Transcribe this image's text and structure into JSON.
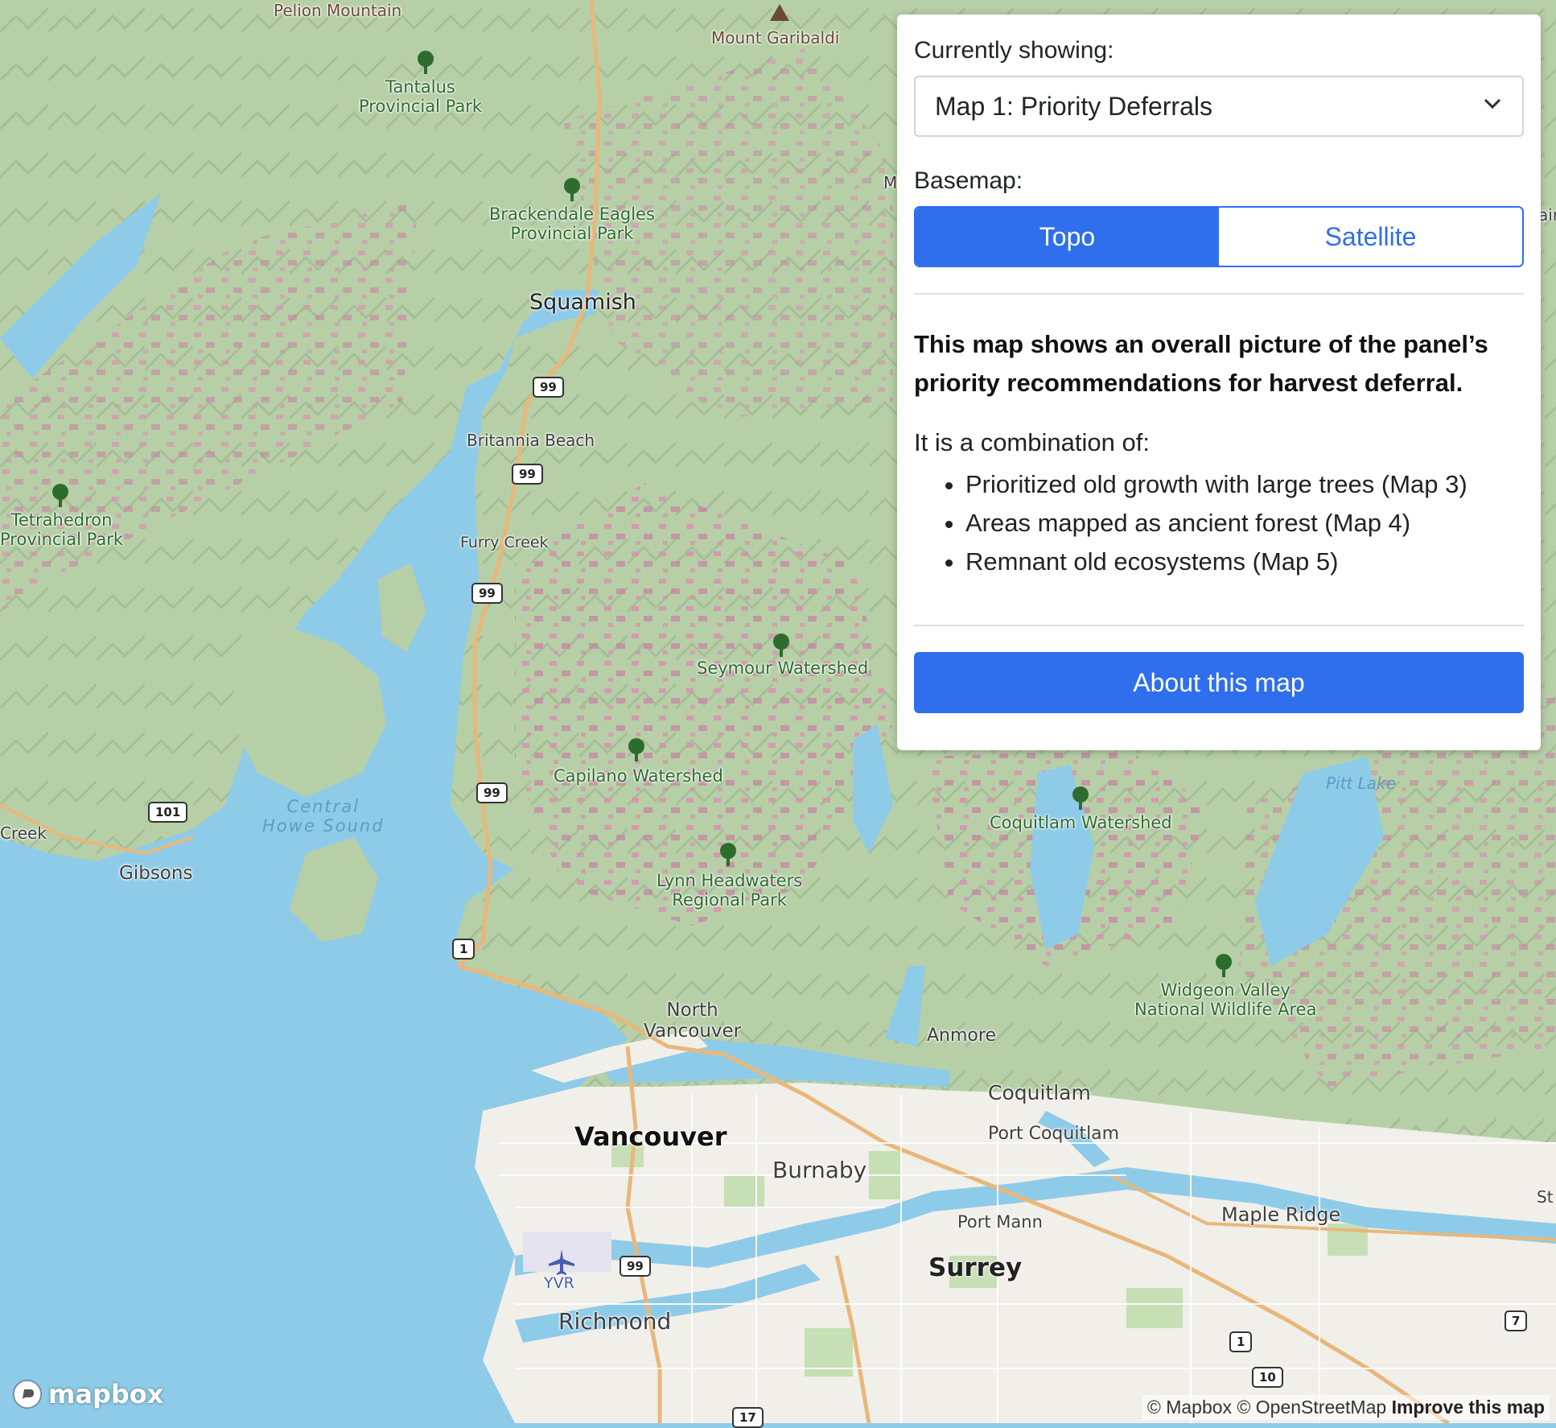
{
  "panel": {
    "currently_showing_label": "Currently showing:",
    "selected_map": "Map 1: Priority Deferrals",
    "basemap_label": "Basemap:",
    "basemap_options": [
      "Topo",
      "Satellite"
    ],
    "basemap_selected": "Topo",
    "description_bold": "This map shows an overall picture of the panel’s priority recommendations for harvest deferral.",
    "combination_intro": "It is a combination of:",
    "combination_items": [
      "Prioritized old growth with large trees (Map 3)",
      "Areas mapped as ancient forest (Map 4)",
      "Remnant old ecosystems (Map 5)"
    ],
    "about_button": "About this map"
  },
  "map": {
    "labels": {
      "pelion": "Pelion Mountain",
      "garibaldi": "Mount Garibaldi",
      "tantalus": "Tantalus\nProvincial Park",
      "brackendale": "Brackendale Eagles\nProvincial Park",
      "squamish": "Squamish",
      "britannia": "Britannia Beach",
      "furry": "Furry Creek",
      "tetrahedron": "Tetrahedron\nProvincial Park",
      "seymour": "Seymour Watershed",
      "capilano": "Capilano Watershed",
      "central": "Central\nHowe Sound",
      "creek": "Creek",
      "gibsons": "Gibsons",
      "lynn": "Lynn Headwaters\nRegional Park",
      "coquitlam_ws": "Coquitlam Watershed",
      "pitt": "Pitt Lake",
      "widgeon": "Widgeon Valley\nNational Wildlife Area",
      "north_van": "North\nVancouver",
      "anmore": "Anmore",
      "coquitlam": "Coquitlam",
      "port_coquitlam": "Port Coquitlam",
      "vancouver": "Vancouver",
      "burnaby": "Burnaby",
      "port_mann": "Port Mann",
      "maple_ridge": "Maple Ridge",
      "surrey": "Surrey",
      "yvr": "YVR",
      "richmond": "Richmond",
      "m_partial": "M",
      "ain_partial": "ain",
      "st_partial": "St"
    },
    "route_shields": [
      "99",
      "99",
      "99",
      "99",
      "101",
      "1",
      "99",
      "1",
      "10",
      "7",
      "17"
    ]
  },
  "attribution": {
    "mapbox": "© Mapbox",
    "osm": "© OpenStreetMap",
    "improve": "Improve this map"
  },
  "logo_text": "mapbox",
  "colors": {
    "water": "#8ecbe8",
    "terrain": "#b6cfa7",
    "urban": "#f1efe9",
    "deferral_pink": "#d98fb0",
    "accent_blue": "#2f6fed",
    "road": "#e8b77a"
  }
}
